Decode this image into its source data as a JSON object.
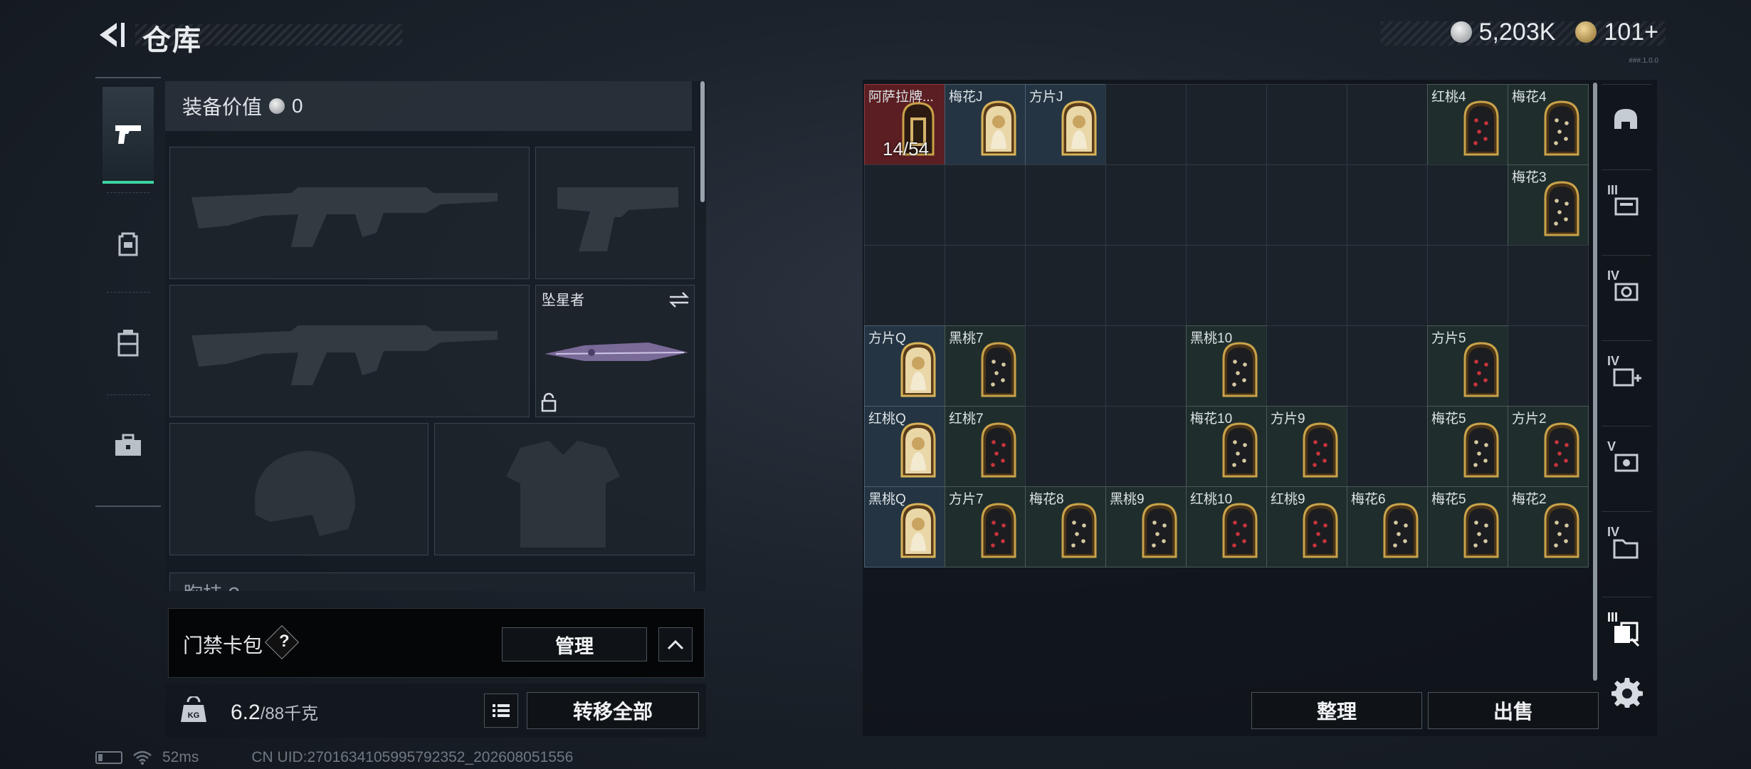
{
  "header": {
    "title": "仓库",
    "currency_silver": "5,203K",
    "currency_gold": "101+",
    "version": "###.1.0.0"
  },
  "left_nav": [
    "weapon-icon",
    "backpack-icon",
    "rig-icon",
    "case-icon"
  ],
  "equipment": {
    "value_label": "装备价值",
    "value": "0",
    "melee_name": "坠星者",
    "chest_label": "胸挂 ?"
  },
  "keycard": {
    "label": "门禁卡包",
    "help": "?",
    "manage": "管理"
  },
  "weight": {
    "current": "6.2",
    "capacity": "/88千克",
    "transfer_all": "转移全部"
  },
  "status": {
    "ping": "52ms",
    "uid": "CN UID:2701634105995792352_202608051556"
  },
  "stash": {
    "sort": "整理",
    "sell": "出售",
    "items": [
      {
        "r": 0,
        "c": 0,
        "label": "阿萨拉牌...",
        "type": "red",
        "count": "14/54"
      },
      {
        "r": 0,
        "c": 1,
        "label": "梅花J",
        "type": "gold"
      },
      {
        "r": 0,
        "c": 2,
        "label": "方片J",
        "type": "gold"
      },
      {
        "r": 0,
        "c": 7,
        "label": "红桃4",
        "type": "plain",
        "suit": "heart"
      },
      {
        "r": 0,
        "c": 8,
        "label": "梅花4",
        "type": "plain",
        "suit": "club"
      },
      {
        "r": 1,
        "c": 8,
        "label": "梅花3",
        "type": "plain",
        "suit": "club"
      },
      {
        "r": 3,
        "c": 0,
        "label": "方片Q",
        "type": "gold"
      },
      {
        "r": 3,
        "c": 1,
        "label": "黑桃7",
        "type": "plain",
        "suit": "spade"
      },
      {
        "r": 3,
        "c": 4,
        "label": "黑桃10",
        "type": "plain",
        "suit": "spade"
      },
      {
        "r": 3,
        "c": 7,
        "label": "方片5",
        "type": "plain",
        "suit": "diamond"
      },
      {
        "r": 4,
        "c": 0,
        "label": "红桃Q",
        "type": "gold"
      },
      {
        "r": 4,
        "c": 1,
        "label": "红桃7",
        "type": "plain",
        "suit": "heart"
      },
      {
        "r": 4,
        "c": 4,
        "label": "梅花10",
        "type": "plain",
        "suit": "club"
      },
      {
        "r": 4,
        "c": 5,
        "label": "方片9",
        "type": "plain",
        "suit": "diamond"
      },
      {
        "r": 4,
        "c": 7,
        "label": "梅花5",
        "type": "plain",
        "suit": "club"
      },
      {
        "r": 4,
        "c": 8,
        "label": "方片2",
        "type": "plain",
        "suit": "diamond"
      },
      {
        "r": 5,
        "c": 0,
        "label": "黑桃Q",
        "type": "gold"
      },
      {
        "r": 5,
        "c": 1,
        "label": "方片7",
        "type": "plain",
        "suit": "diamond"
      },
      {
        "r": 5,
        "c": 2,
        "label": "梅花8",
        "type": "plain",
        "suit": "club"
      },
      {
        "r": 5,
        "c": 3,
        "label": "黑桃9",
        "type": "plain",
        "suit": "spade"
      },
      {
        "r": 5,
        "c": 4,
        "label": "红桃10",
        "type": "plain",
        "suit": "heart"
      },
      {
        "r": 5,
        "c": 5,
        "label": "红桃9",
        "type": "plain",
        "suit": "heart"
      },
      {
        "r": 5,
        "c": 6,
        "label": "梅花6",
        "type": "plain",
        "suit": "club"
      },
      {
        "r": 5,
        "c": 7,
        "label": "梅花5",
        "type": "plain",
        "suit": "club"
      },
      {
        "r": 5,
        "c": 8,
        "label": "梅花2",
        "type": "plain",
        "suit": "club"
      }
    ]
  },
  "right_tabs": [
    {
      "tier": "",
      "icon": "helmet-icon"
    },
    {
      "tier": "III",
      "icon": "rig-tab-icon"
    },
    {
      "tier": "IV",
      "icon": "vest-tab-icon"
    },
    {
      "tier": "IV",
      "icon": "medkit-tab-icon"
    },
    {
      "tier": "V",
      "icon": "armor-tab-icon"
    },
    {
      "tier": "IV",
      "icon": "folder-tab-icon"
    },
    {
      "tier": "III",
      "icon": "cards-tab-icon"
    }
  ],
  "colors": {
    "accent": "#3fd3a0",
    "card_red_bg": "#5b1e22",
    "card_gold_bg": "#243442",
    "card_plain_bg": "#1f2e2c"
  }
}
